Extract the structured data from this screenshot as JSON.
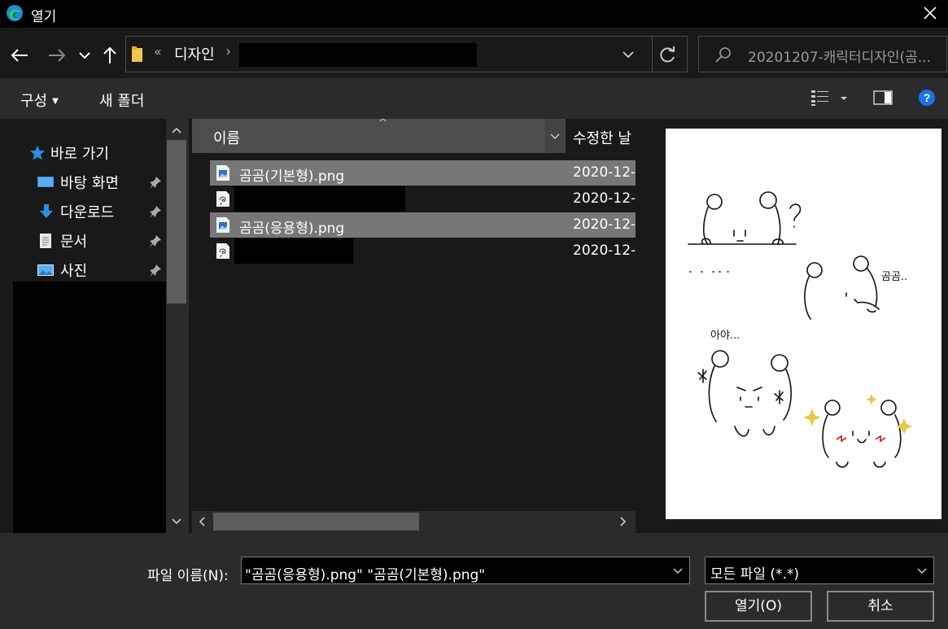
{
  "window": {
    "title": "열기"
  },
  "address": {
    "overflow": "«",
    "breadcrumb": "디자인",
    "separator": "›"
  },
  "search": {
    "placeholder": "20201207-캐릭터디자인(곰..."
  },
  "toolbar": {
    "organize": "구성",
    "new_folder": "새 폴더"
  },
  "nav": {
    "quick_access": "바로 가기",
    "items": [
      {
        "label": "바탕 화면",
        "icon": "desktop-icon"
      },
      {
        "label": "다운로드",
        "icon": "download-icon"
      },
      {
        "label": "문서",
        "icon": "document-icon"
      },
      {
        "label": "사진",
        "icon": "pictures-icon"
      }
    ]
  },
  "columns": {
    "name": "이름",
    "modified": "수정한 날"
  },
  "files": [
    {
      "name": "곰곰(기본형).png",
      "date": "2020-12-",
      "selected": true,
      "icon": "png-file-icon"
    },
    {
      "name": "",
      "date": "2020-12-",
      "selected": false,
      "icon": "clip-studio-file-icon"
    },
    {
      "name": "곰곰(응용형).png",
      "date": "2020-12-",
      "selected": true,
      "icon": "png-file-icon"
    },
    {
      "name": "",
      "date": "2020-12-",
      "selected": false,
      "icon": "clip-studio-file-icon"
    }
  ],
  "preview": {
    "sketch_text_1": "곰곰..",
    "sketch_text_2": "아야..."
  },
  "bottom": {
    "filename_label": "파일 이름(N):",
    "filename_value": "\"곰곰(응용형).png\" \"곰곰(기본형).png\"",
    "filetype_value": "모든 파일 (*.*)",
    "open_button": "열기(O)",
    "cancel_button": "취소"
  },
  "colors": {
    "accent": "#0078d7",
    "selection": "#777777",
    "folder": "#f3c54a",
    "help": "#1a73e8"
  }
}
